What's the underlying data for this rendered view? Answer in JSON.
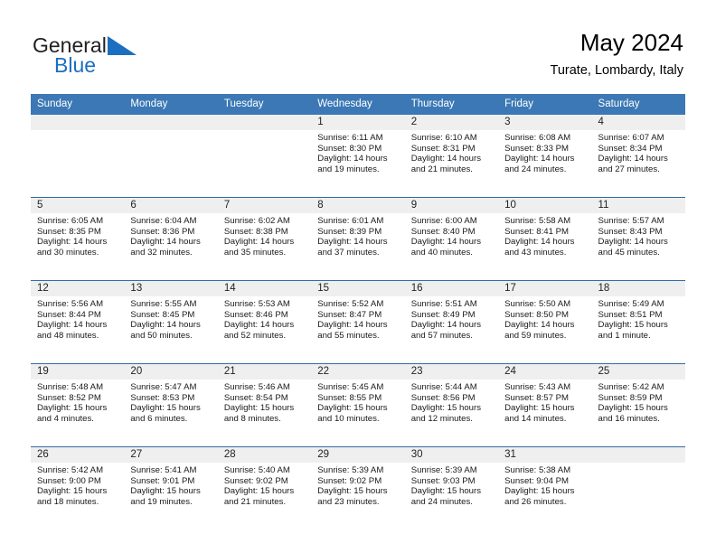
{
  "brand": {
    "name_part1": "General",
    "name_part2": "Blue",
    "logo_icon": "blue-triangle-flag-icon"
  },
  "header": {
    "title": "May 2024",
    "subtitle": "Turate, Lombardy, Italy"
  },
  "colors": {
    "header_blue": "#3b78b5",
    "row_divider_blue": "#2f6da6",
    "daynum_band": "#efefef",
    "brand_blue": "#1c6fc0"
  },
  "weekdays": [
    "Sunday",
    "Monday",
    "Tuesday",
    "Wednesday",
    "Thursday",
    "Friday",
    "Saturday"
  ],
  "labels": {
    "sunrise": "Sunrise:",
    "sunset": "Sunset:",
    "daylight": "Daylight:"
  },
  "weeks": [
    [
      {
        "day": "",
        "empty": true
      },
      {
        "day": "",
        "empty": true
      },
      {
        "day": "",
        "empty": true
      },
      {
        "day": "1",
        "sunrise": "Sunrise: 6:11 AM",
        "sunset": "Sunset: 8:30 PM",
        "daylight1": "Daylight: 14 hours",
        "daylight2": "and 19 minutes."
      },
      {
        "day": "2",
        "sunrise": "Sunrise: 6:10 AM",
        "sunset": "Sunset: 8:31 PM",
        "daylight1": "Daylight: 14 hours",
        "daylight2": "and 21 minutes."
      },
      {
        "day": "3",
        "sunrise": "Sunrise: 6:08 AM",
        "sunset": "Sunset: 8:33 PM",
        "daylight1": "Daylight: 14 hours",
        "daylight2": "and 24 minutes."
      },
      {
        "day": "4",
        "sunrise": "Sunrise: 6:07 AM",
        "sunset": "Sunset: 8:34 PM",
        "daylight1": "Daylight: 14 hours",
        "daylight2": "and 27 minutes."
      }
    ],
    [
      {
        "day": "5",
        "sunrise": "Sunrise: 6:05 AM",
        "sunset": "Sunset: 8:35 PM",
        "daylight1": "Daylight: 14 hours",
        "daylight2": "and 30 minutes."
      },
      {
        "day": "6",
        "sunrise": "Sunrise: 6:04 AM",
        "sunset": "Sunset: 8:36 PM",
        "daylight1": "Daylight: 14 hours",
        "daylight2": "and 32 minutes."
      },
      {
        "day": "7",
        "sunrise": "Sunrise: 6:02 AM",
        "sunset": "Sunset: 8:38 PM",
        "daylight1": "Daylight: 14 hours",
        "daylight2": "and 35 minutes."
      },
      {
        "day": "8",
        "sunrise": "Sunrise: 6:01 AM",
        "sunset": "Sunset: 8:39 PM",
        "daylight1": "Daylight: 14 hours",
        "daylight2": "and 37 minutes."
      },
      {
        "day": "9",
        "sunrise": "Sunrise: 6:00 AM",
        "sunset": "Sunset: 8:40 PM",
        "daylight1": "Daylight: 14 hours",
        "daylight2": "and 40 minutes."
      },
      {
        "day": "10",
        "sunrise": "Sunrise: 5:58 AM",
        "sunset": "Sunset: 8:41 PM",
        "daylight1": "Daylight: 14 hours",
        "daylight2": "and 43 minutes."
      },
      {
        "day": "11",
        "sunrise": "Sunrise: 5:57 AM",
        "sunset": "Sunset: 8:43 PM",
        "daylight1": "Daylight: 14 hours",
        "daylight2": "and 45 minutes."
      }
    ],
    [
      {
        "day": "12",
        "sunrise": "Sunrise: 5:56 AM",
        "sunset": "Sunset: 8:44 PM",
        "daylight1": "Daylight: 14 hours",
        "daylight2": "and 48 minutes."
      },
      {
        "day": "13",
        "sunrise": "Sunrise: 5:55 AM",
        "sunset": "Sunset: 8:45 PM",
        "daylight1": "Daylight: 14 hours",
        "daylight2": "and 50 minutes."
      },
      {
        "day": "14",
        "sunrise": "Sunrise: 5:53 AM",
        "sunset": "Sunset: 8:46 PM",
        "daylight1": "Daylight: 14 hours",
        "daylight2": "and 52 minutes."
      },
      {
        "day": "15",
        "sunrise": "Sunrise: 5:52 AM",
        "sunset": "Sunset: 8:47 PM",
        "daylight1": "Daylight: 14 hours",
        "daylight2": "and 55 minutes."
      },
      {
        "day": "16",
        "sunrise": "Sunrise: 5:51 AM",
        "sunset": "Sunset: 8:49 PM",
        "daylight1": "Daylight: 14 hours",
        "daylight2": "and 57 minutes."
      },
      {
        "day": "17",
        "sunrise": "Sunrise: 5:50 AM",
        "sunset": "Sunset: 8:50 PM",
        "daylight1": "Daylight: 14 hours",
        "daylight2": "and 59 minutes."
      },
      {
        "day": "18",
        "sunrise": "Sunrise: 5:49 AM",
        "sunset": "Sunset: 8:51 PM",
        "daylight1": "Daylight: 15 hours",
        "daylight2": "and 1 minute."
      }
    ],
    [
      {
        "day": "19",
        "sunrise": "Sunrise: 5:48 AM",
        "sunset": "Sunset: 8:52 PM",
        "daylight1": "Daylight: 15 hours",
        "daylight2": "and 4 minutes."
      },
      {
        "day": "20",
        "sunrise": "Sunrise: 5:47 AM",
        "sunset": "Sunset: 8:53 PM",
        "daylight1": "Daylight: 15 hours",
        "daylight2": "and 6 minutes."
      },
      {
        "day": "21",
        "sunrise": "Sunrise: 5:46 AM",
        "sunset": "Sunset: 8:54 PM",
        "daylight1": "Daylight: 15 hours",
        "daylight2": "and 8 minutes."
      },
      {
        "day": "22",
        "sunrise": "Sunrise: 5:45 AM",
        "sunset": "Sunset: 8:55 PM",
        "daylight1": "Daylight: 15 hours",
        "daylight2": "and 10 minutes."
      },
      {
        "day": "23",
        "sunrise": "Sunrise: 5:44 AM",
        "sunset": "Sunset: 8:56 PM",
        "daylight1": "Daylight: 15 hours",
        "daylight2": "and 12 minutes."
      },
      {
        "day": "24",
        "sunrise": "Sunrise: 5:43 AM",
        "sunset": "Sunset: 8:57 PM",
        "daylight1": "Daylight: 15 hours",
        "daylight2": "and 14 minutes."
      },
      {
        "day": "25",
        "sunrise": "Sunrise: 5:42 AM",
        "sunset": "Sunset: 8:59 PM",
        "daylight1": "Daylight: 15 hours",
        "daylight2": "and 16 minutes."
      }
    ],
    [
      {
        "day": "26",
        "sunrise": "Sunrise: 5:42 AM",
        "sunset": "Sunset: 9:00 PM",
        "daylight1": "Daylight: 15 hours",
        "daylight2": "and 18 minutes."
      },
      {
        "day": "27",
        "sunrise": "Sunrise: 5:41 AM",
        "sunset": "Sunset: 9:01 PM",
        "daylight1": "Daylight: 15 hours",
        "daylight2": "and 19 minutes."
      },
      {
        "day": "28",
        "sunrise": "Sunrise: 5:40 AM",
        "sunset": "Sunset: 9:02 PM",
        "daylight1": "Daylight: 15 hours",
        "daylight2": "and 21 minutes."
      },
      {
        "day": "29",
        "sunrise": "Sunrise: 5:39 AM",
        "sunset": "Sunset: 9:02 PM",
        "daylight1": "Daylight: 15 hours",
        "daylight2": "and 23 minutes."
      },
      {
        "day": "30",
        "sunrise": "Sunrise: 5:39 AM",
        "sunset": "Sunset: 9:03 PM",
        "daylight1": "Daylight: 15 hours",
        "daylight2": "and 24 minutes."
      },
      {
        "day": "31",
        "sunrise": "Sunrise: 5:38 AM",
        "sunset": "Sunset: 9:04 PM",
        "daylight1": "Daylight: 15 hours",
        "daylight2": "and 26 minutes."
      },
      {
        "day": "",
        "empty": true
      }
    ]
  ]
}
